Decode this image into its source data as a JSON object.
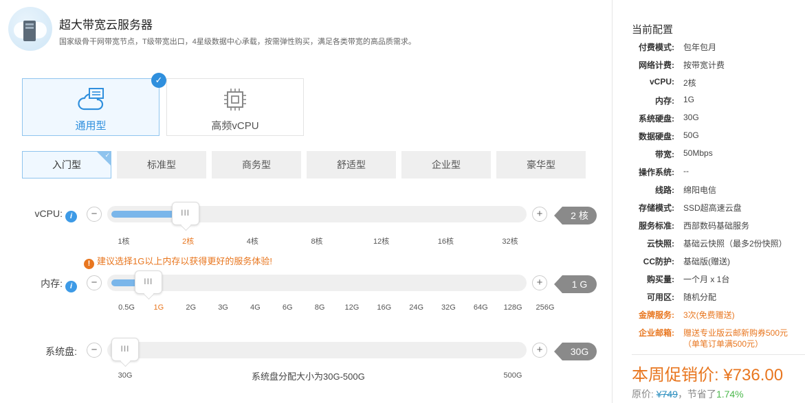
{
  "header": {
    "title": "超大带宽云服务器",
    "subtitle": "国家级骨干网带宽节点，T级带宽出口，4星级数据中心承载，按需弹性购买，满足各类带宽的高品质需求。"
  },
  "types": [
    {
      "label": "通用型",
      "icon": "cloud-server-icon",
      "active": true
    },
    {
      "label": "高频vCPU",
      "icon": "cpu-chip-icon",
      "active": false
    }
  ],
  "tiers": [
    {
      "label": "入门型",
      "active": true
    },
    {
      "label": "标准型",
      "active": false
    },
    {
      "label": "商务型",
      "active": false
    },
    {
      "label": "舒适型",
      "active": false
    },
    {
      "label": "企业型",
      "active": false
    },
    {
      "label": "豪华型",
      "active": false
    }
  ],
  "vcpu": {
    "label": "vCPU:",
    "value": "2 核",
    "fill_fraction": 0.18,
    "knob_text": "III",
    "ticks": [
      "1核",
      "2核",
      "4核",
      "8核",
      "12核",
      "16核",
      "32核"
    ],
    "selected_tick": "2核"
  },
  "memory_warning": "建议选择1G以上内存以获得更好的服务体验!",
  "memory": {
    "label": "内存:",
    "value": "1 G",
    "fill_fraction": 0.09,
    "knob_text": "III",
    "ticks": [
      "0.5G",
      "1G",
      "2G",
      "3G",
      "4G",
      "6G",
      "8G",
      "12G",
      "16G",
      "24G",
      "32G",
      "64G",
      "128G",
      "256G"
    ],
    "selected_tick": "1G"
  },
  "disk": {
    "label": "系统盘:",
    "value": "30G",
    "fill_fraction": 0.0,
    "knob_text": "III",
    "min_label": "30G",
    "max_label": "500G",
    "note": "系统盘分配大小为30G-500G"
  },
  "controls": {
    "minus": "−",
    "plus": "+"
  },
  "summary": {
    "title": "当前配置",
    "rows": [
      {
        "k": "付费模式:",
        "v": "包年包月"
      },
      {
        "k": "网络计费:",
        "v": "按带宽计费"
      },
      {
        "k": "vCPU:",
        "v": "2核"
      },
      {
        "k": "内存:",
        "v": "1G"
      },
      {
        "k": "系统硬盘:",
        "v": "30G"
      },
      {
        "k": "数据硬盘:",
        "v": "50G"
      },
      {
        "k": "带宽:",
        "v": "50Mbps"
      },
      {
        "k": "操作系统:",
        "v": "--"
      },
      {
        "k": "线路:",
        "v": "绵阳电信"
      },
      {
        "k": "存储模式:",
        "v": "SSD超高速云盘"
      },
      {
        "k": "服务标准:",
        "v": "西部数码基础服务"
      },
      {
        "k": "云快照:",
        "v": "基础云快照（最多2份快照）"
      },
      {
        "k": "CC防护:",
        "v": "基础版(赠送)"
      },
      {
        "k": "购买量:",
        "v": "一个月 x 1台"
      },
      {
        "k": "可用区:",
        "v": "随机分配"
      },
      {
        "k": "金牌服务:",
        "v": "3次(免费赠送)",
        "orange": true
      },
      {
        "k": "企业邮箱:",
        "v": "赠送专业版云邮新购券500元",
        "v2": "（单笔订单满500元）",
        "orange": true
      }
    ],
    "promo_label": "本周促销价: ¥736.00",
    "original_prefix": "原价: ",
    "original_price": "¥749",
    "saved_prefix": "，节省了",
    "saved_pct": "1.74%"
  },
  "colors": {
    "accent": "#2f8fdd",
    "orange": "#e8761f",
    "fill": "#7ab6ea",
    "tag": "#8a8a8a"
  }
}
